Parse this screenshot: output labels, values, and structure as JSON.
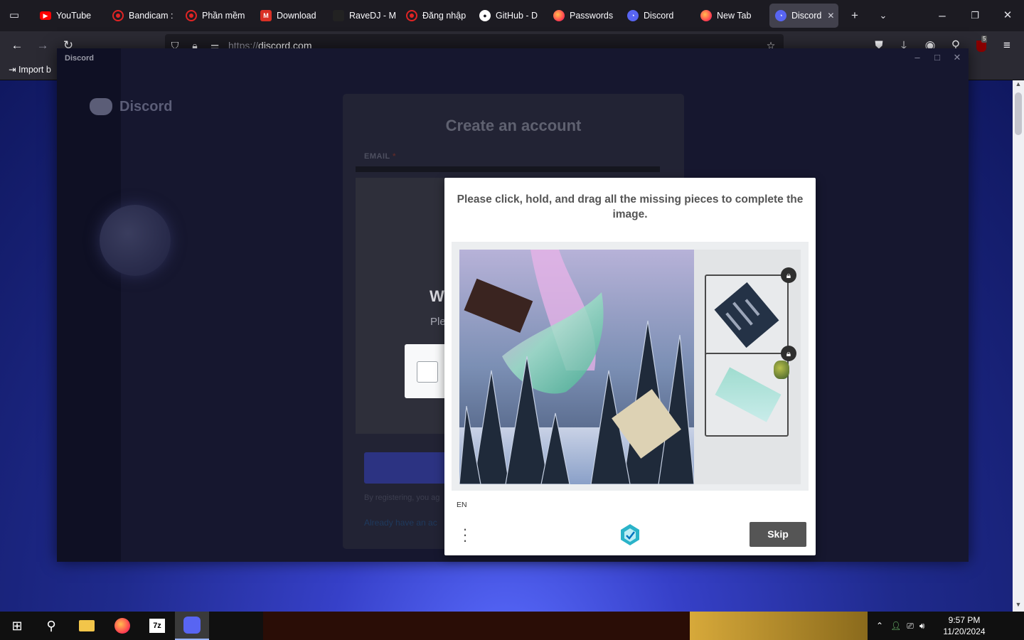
{
  "browser": {
    "tabs": [
      {
        "label": "YouTube",
        "icon": "youtube-icon",
        "color": "#ff0000"
      },
      {
        "label": "Bandicam :",
        "icon": "record-icon",
        "color": "#e02424"
      },
      {
        "label": "Phần mềm",
        "icon": "record-icon",
        "color": "#e02424"
      },
      {
        "label": "Download",
        "icon": "gmail-icon",
        "color": "#d93025"
      },
      {
        "label": "RaveDJ - M",
        "icon": "ravedj-icon",
        "color": "#222222"
      },
      {
        "label": "Đăng nhập",
        "icon": "record-icon",
        "color": "#e02424"
      },
      {
        "label": "GitHub - D",
        "icon": "github-icon",
        "color": "#ffffff"
      },
      {
        "label": "Passwords",
        "icon": "firefox-icon",
        "color": "#ff7139"
      },
      {
        "label": "Discord",
        "icon": "discord-icon",
        "color": "#5865f2"
      },
      {
        "label": "New Tab",
        "icon": "firefox-icon",
        "color": "#ff7139"
      },
      {
        "label": "Discord",
        "icon": "discord-icon",
        "color": "#5865f2",
        "active": true
      }
    ],
    "url_scheme": "https://",
    "url_host": "discord.com",
    "bookmark_import": "Import b"
  },
  "discord_window": {
    "title": "Discord",
    "brand": "Discord",
    "card_title": "Create an account",
    "email_label": "EMAIL",
    "email_required_mark": "*",
    "partial_heading": "W",
    "partial_text": "Ple",
    "tos_partial": "By registering, you ag",
    "login_partial": "Already have an ac"
  },
  "captcha": {
    "prompt": "Please click, hold, and drag all the missing pieces to complete the image.",
    "language": "EN",
    "skip_label": "Skip",
    "brand_color": "#0074bf"
  },
  "taskbar": {
    "time": "9:57 PM",
    "date": "11/20/2024",
    "notification_badge": "5"
  }
}
